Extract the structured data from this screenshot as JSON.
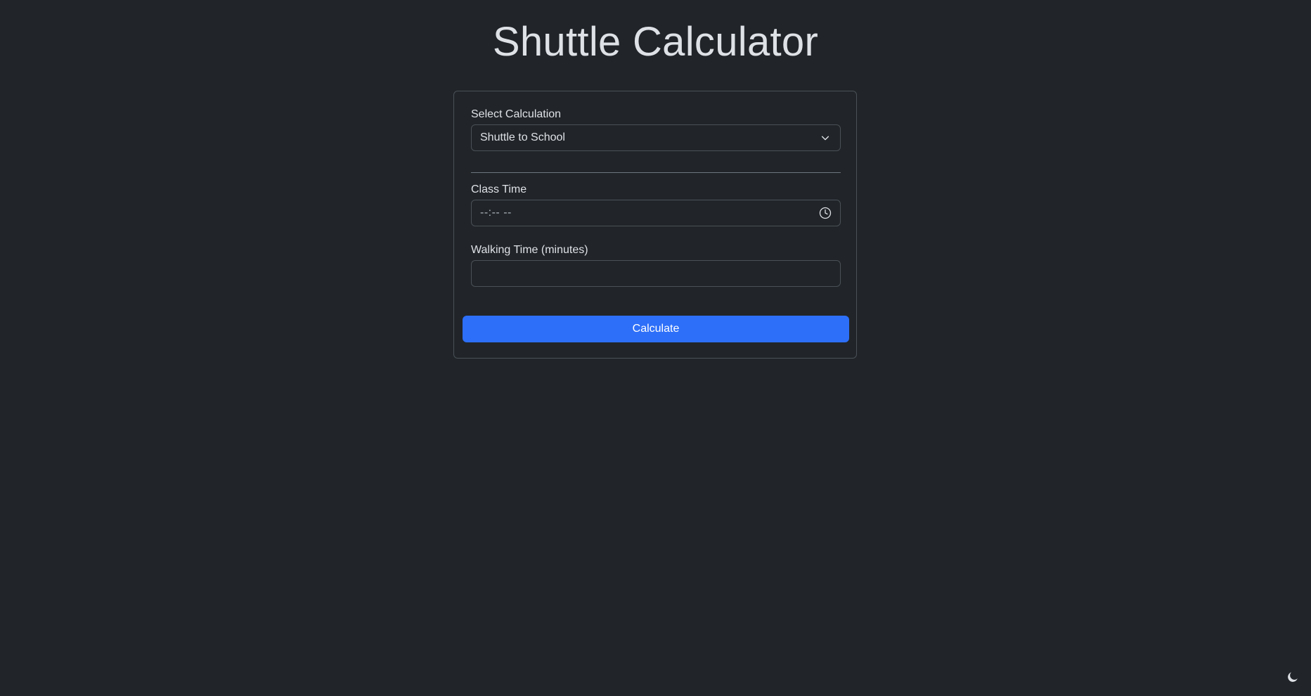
{
  "header": {
    "title": "Shuttle Calculator"
  },
  "form": {
    "select_label": "Select Calculation",
    "select_value": "Shuttle to School",
    "class_time_label": "Class Time",
    "class_time_placeholder": "--:-- --",
    "walking_time_label": "Walking Time (minutes)",
    "walking_time_value": "",
    "calculate_label": "Calculate"
  },
  "icons": {
    "select": "chevron-down-icon",
    "time": "clock-icon",
    "theme": "moon-icon"
  },
  "colors": {
    "background": "#212529",
    "primary": "#2d6ff8",
    "border": "#495057"
  }
}
